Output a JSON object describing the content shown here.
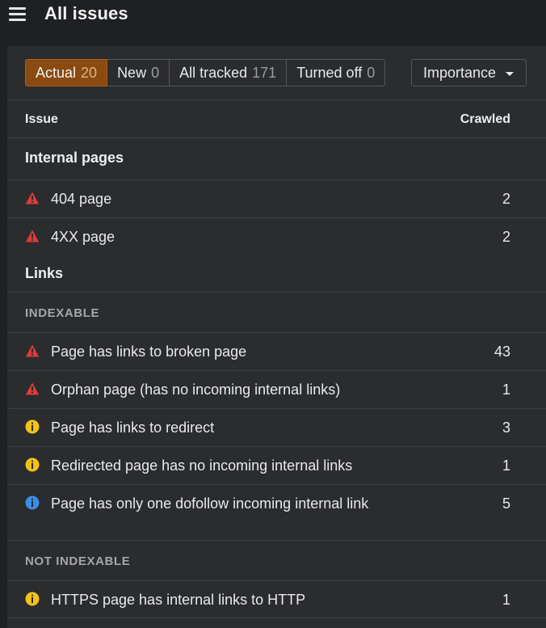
{
  "header": {
    "title": "All issues",
    "menu_icon": "hamburger-menu-icon"
  },
  "filters": {
    "tabs": [
      {
        "label": "Actual",
        "count": "20",
        "active": true
      },
      {
        "label": "New",
        "count": "0",
        "active": false
      },
      {
        "label": "All tracked",
        "count": "171",
        "active": false
      },
      {
        "label": "Turned off",
        "count": "0",
        "active": false
      }
    ],
    "sort_label": "Importance"
  },
  "table": {
    "col_issue": "Issue",
    "col_crawled": "Crawled",
    "groups": {
      "internal_pages": {
        "label": "Internal pages",
        "rows": [
          {
            "icon": "error-triangle-icon",
            "text": "404 page",
            "crawled": "2"
          },
          {
            "icon": "error-triangle-icon",
            "text": "4XX page",
            "crawled": "2"
          }
        ]
      },
      "links": {
        "label": "Links",
        "indexable": {
          "label": "INDEXABLE",
          "rows": [
            {
              "icon": "error-triangle-icon",
              "text": "Page has links to broken page",
              "crawled": "43"
            },
            {
              "icon": "error-triangle-icon",
              "text": "Orphan page (has no incoming internal links)",
              "crawled": "1"
            },
            {
              "icon": "warning-circle-icon",
              "text": "Page has links to redirect",
              "crawled": "3"
            },
            {
              "icon": "warning-circle-icon",
              "text": "Redirected page has no incoming internal links",
              "crawled": "1"
            },
            {
              "icon": "info-circle-icon",
              "text": "Page has only one dofollow incoming internal link",
              "crawled": "5"
            }
          ]
        },
        "not_indexable": {
          "label": "NOT INDEXABLE",
          "rows": [
            {
              "icon": "warning-circle-icon",
              "text": "HTTPS page has internal links to HTTP",
              "crawled": "1"
            }
          ]
        }
      }
    }
  },
  "colors": {
    "error": "#e03a3a",
    "warning": "#f2c21b",
    "notice": "#3a8ee6",
    "active_tab": "#8a4a10"
  }
}
